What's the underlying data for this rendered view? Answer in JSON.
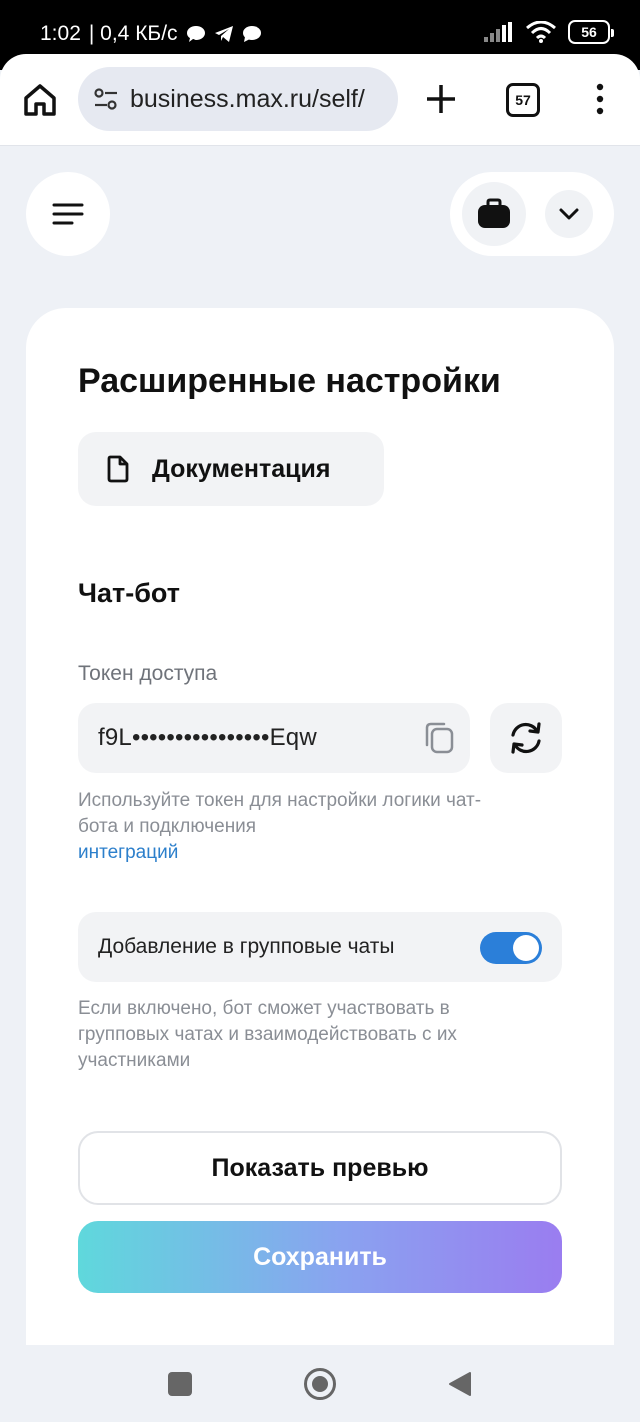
{
  "status_bar": {
    "time": "1:02",
    "speed": "| 0,4 КБ/с",
    "battery": "56",
    "icons": [
      "message-icon",
      "telegram-icon",
      "chat-icon",
      "signal-icon",
      "wifi-icon",
      "battery-icon"
    ]
  },
  "browser": {
    "url": "business.max.ru/self/",
    "tab_count": "57",
    "icons": [
      "home-icon",
      "site-settings-icon",
      "new-tab-icon",
      "tabs-icon",
      "more-icon"
    ]
  },
  "header": {
    "icons": [
      "hamburger-icon",
      "briefcase-icon",
      "chevron-down-icon"
    ]
  },
  "main": {
    "title": "Расширенные настройки",
    "doc_button": "Документация",
    "section_title": "Чат-бот",
    "token_label": "Токен доступа",
    "token_value": "f9L••••••••••••••••Eqw",
    "token_hint": "Используйте токен для настройки логики чат-бота и подключения",
    "token_hint_link": "интеграций",
    "group_toggle_label": "Добавление в групповые чаты",
    "group_toggle_on": true,
    "group_hint": "Если включено, бот сможет участвовать в групповых чатах и взаимодействовать с их участниками",
    "preview_button": "Показать превью",
    "save_button": "Сохранить"
  },
  "colors": {
    "accent": "#2b7fd9",
    "link": "#2c7fcb",
    "save_gradient_start": "#5fd8dc",
    "save_gradient_end": "#9a7df0"
  }
}
